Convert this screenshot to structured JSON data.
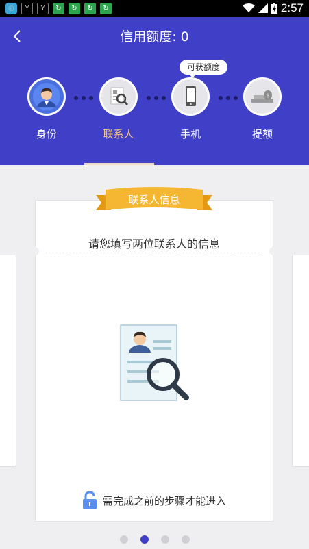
{
  "status_bar": {
    "time": "2:57",
    "notification_icons": [
      "app-icon",
      "sim-icon",
      "sim-icon",
      "refresh-icon",
      "refresh-icon",
      "refresh-icon",
      "refresh-icon"
    ]
  },
  "header": {
    "title": "信用额度: 0",
    "badge": "可获额度",
    "background_color": "#3f3fc7",
    "steps": [
      {
        "label": "身份",
        "state": "done",
        "icon": "person-icon"
      },
      {
        "label": "联系人",
        "state": "active",
        "icon": "contact-search-icon"
      },
      {
        "label": "手机",
        "state": "todo",
        "icon": "phone-icon"
      },
      {
        "label": "提额",
        "state": "todo",
        "icon": "money-icon"
      }
    ]
  },
  "card": {
    "ribbon_title": "联系人信息",
    "heading": "请您填写两位联系人的信息",
    "lock_message": "需完成之前的步骤才能进入",
    "ribbon_color": "#f5b731"
  },
  "pager": {
    "count": 4,
    "active_index": 1
  }
}
